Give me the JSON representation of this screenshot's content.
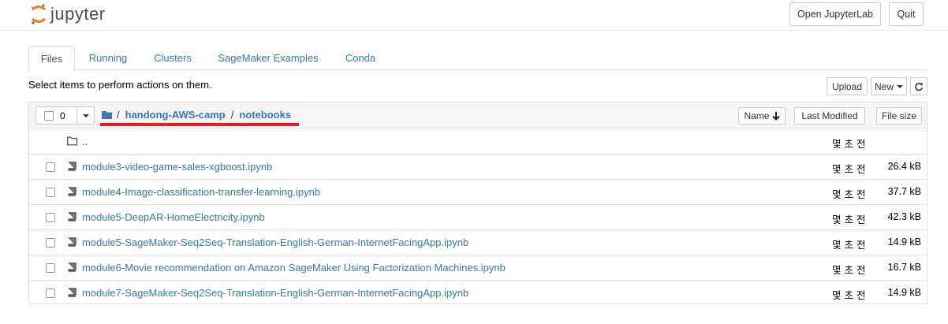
{
  "header": {
    "logo_text": "jupyter",
    "open_lab_label": "Open JupyterLab",
    "quit_label": "Quit"
  },
  "tabs": [
    {
      "label": "Files",
      "active": true
    },
    {
      "label": "Running",
      "active": false
    },
    {
      "label": "Clusters",
      "active": false
    },
    {
      "label": "SageMaker Examples",
      "active": false
    },
    {
      "label": "Conda",
      "active": false
    }
  ],
  "toolbar": {
    "instructions": "Select items to perform actions on them.",
    "upload_label": "Upload",
    "new_label": "New",
    "refresh_icon": "refresh-icon"
  },
  "list_header": {
    "selected_count": "0",
    "breadcrumb": [
      {
        "label": "handong-AWS-camp"
      },
      {
        "label": "notebooks"
      }
    ],
    "root_sep": "/",
    "sep": "/",
    "sort_name_label": "Name",
    "sort_modified_label": "Last Modified",
    "sort_size_label": "File size"
  },
  "parent_row": {
    "name": "..",
    "modified": "몇 초 전"
  },
  "files": [
    {
      "name": "module3-video-game-sales-xgboost.ipynb",
      "modified": "몇 초 전",
      "size": "26.4 kB"
    },
    {
      "name": "module4-Image-classification-transfer-learning.ipynb",
      "modified": "몇 초 전",
      "size": "37.7 kB"
    },
    {
      "name": "module5-DeepAR-HomeElectricity.ipynb",
      "modified": "몇 초 전",
      "size": "42.3 kB"
    },
    {
      "name": "module5-SageMaker-Seq2Seq-Translation-English-German-InternetFacingApp.ipynb",
      "modified": "몇 초 전",
      "size": "14.9 kB"
    },
    {
      "name": "module6-Movie recommendation on Amazon SageMaker Using Factorization Machines.ipynb",
      "modified": "몇 초 전",
      "size": "16.7 kB"
    },
    {
      "name": "module7-SageMaker-Seq2Seq-Translation-English-German-InternetFacingApp.ipynb",
      "modified": "몇 초 전",
      "size": "14.9 kB"
    }
  ],
  "colors": {
    "link": "#337ab7",
    "logo_orange": "#f37726",
    "annotation_red": "#ee1c1c"
  }
}
